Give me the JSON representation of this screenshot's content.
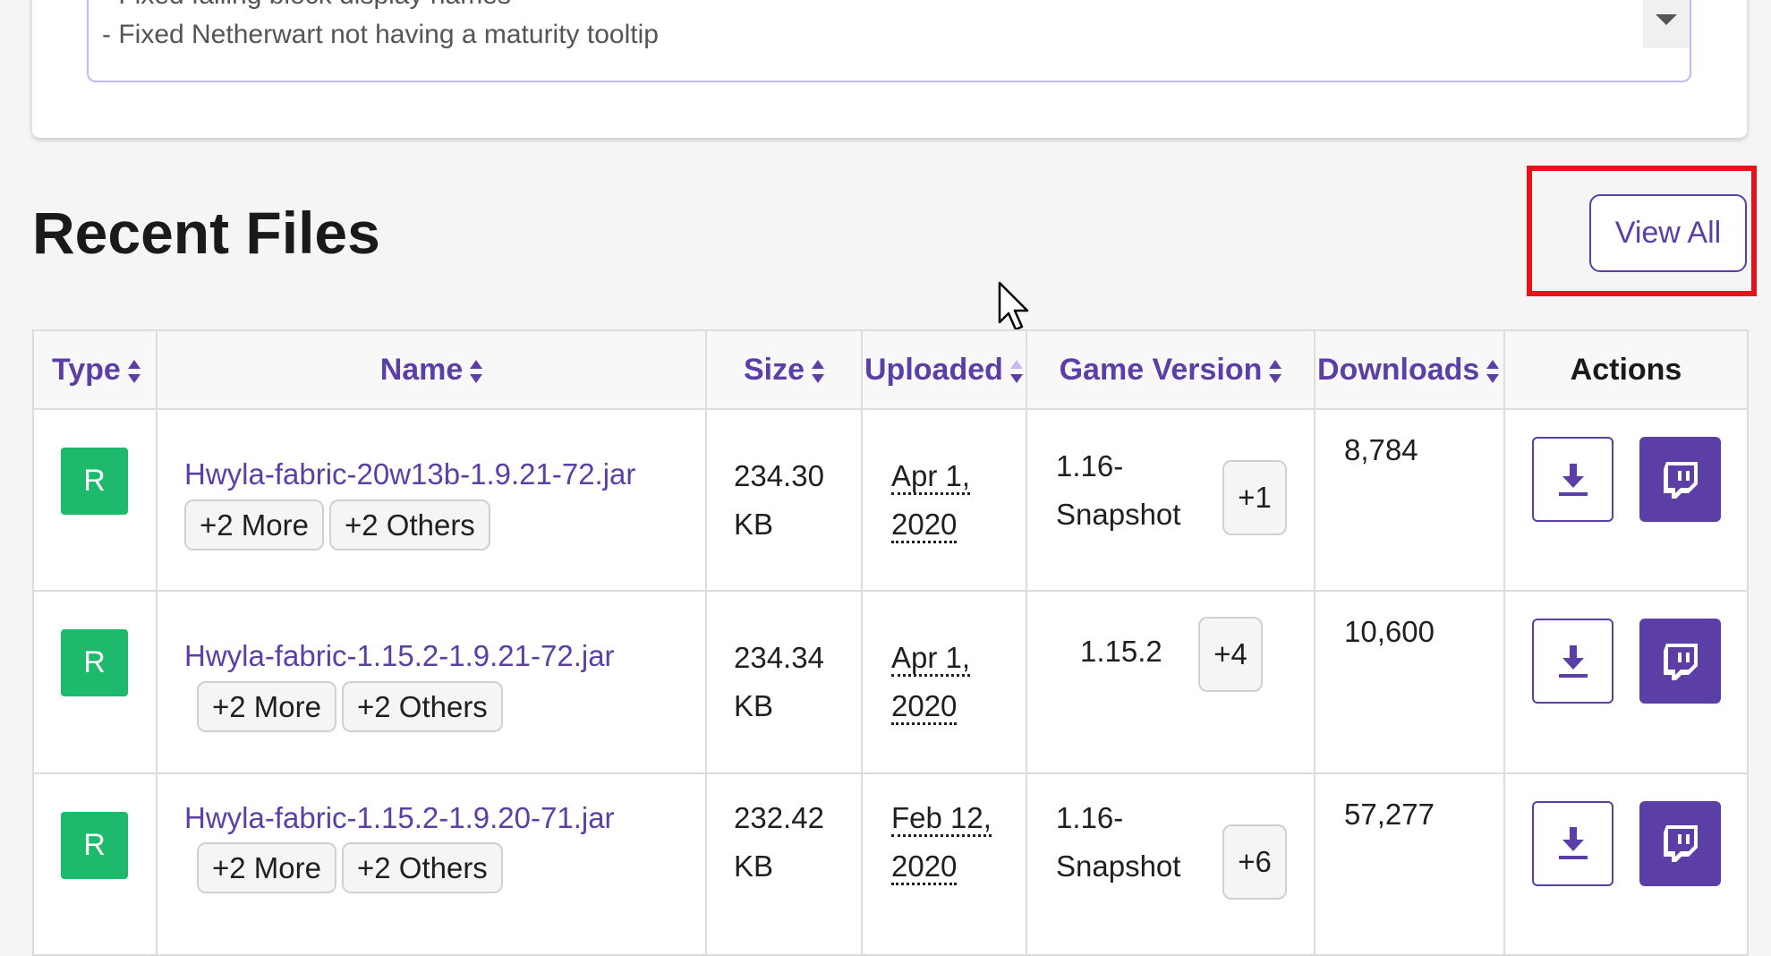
{
  "changelog": {
    "lines": [
      "- Fixed falling block display names",
      "- Fixed Netherwart not having a maturity tooltip"
    ]
  },
  "section": {
    "title": "Recent Files",
    "view_all_label": "View All"
  },
  "table": {
    "headers": {
      "type": "Type",
      "name": "Name",
      "size": "Size",
      "uploaded": "Uploaded",
      "game_version": "Game Version",
      "downloads": "Downloads",
      "actions": "Actions"
    },
    "rows": [
      {
        "type": "R",
        "name": "Hwyla-fabric-20w13b-1.9.21-72.jar",
        "more": "+2 More",
        "others": "+2 Others",
        "size": "234.30 KB",
        "uploaded": "Apr 1, 2020",
        "game_version": "1.16-Snapshot",
        "version_more": "+1",
        "downloads": "8,784"
      },
      {
        "type": "R",
        "name": "Hwyla-fabric-1.15.2-1.9.21-72.jar",
        "more": "+2 More",
        "others": "+2 Others",
        "size": "234.34 KB",
        "uploaded": "Apr 1, 2020",
        "game_version": "1.15.2",
        "version_more": "+4",
        "downloads": "10,600"
      },
      {
        "type": "R",
        "name": "Hwyla-fabric-1.15.2-1.9.20-71.jar",
        "more": "+2 More",
        "others": "+2 Others",
        "size": "232.42 KB",
        "uploaded": "Feb 12, 2020",
        "game_version": "1.16-Snapshot",
        "version_more": "+6",
        "downloads": "57,277"
      }
    ]
  },
  "icons": {
    "download": "download-icon",
    "install": "twitch-icon",
    "sort": "sort-icon",
    "cursor": "mouse-cursor-icon",
    "dropdown": "chevron-down-icon"
  },
  "colors": {
    "accent": "#5b3fa6",
    "release_badge": "#1dba6b",
    "highlight": "#e8121b"
  }
}
